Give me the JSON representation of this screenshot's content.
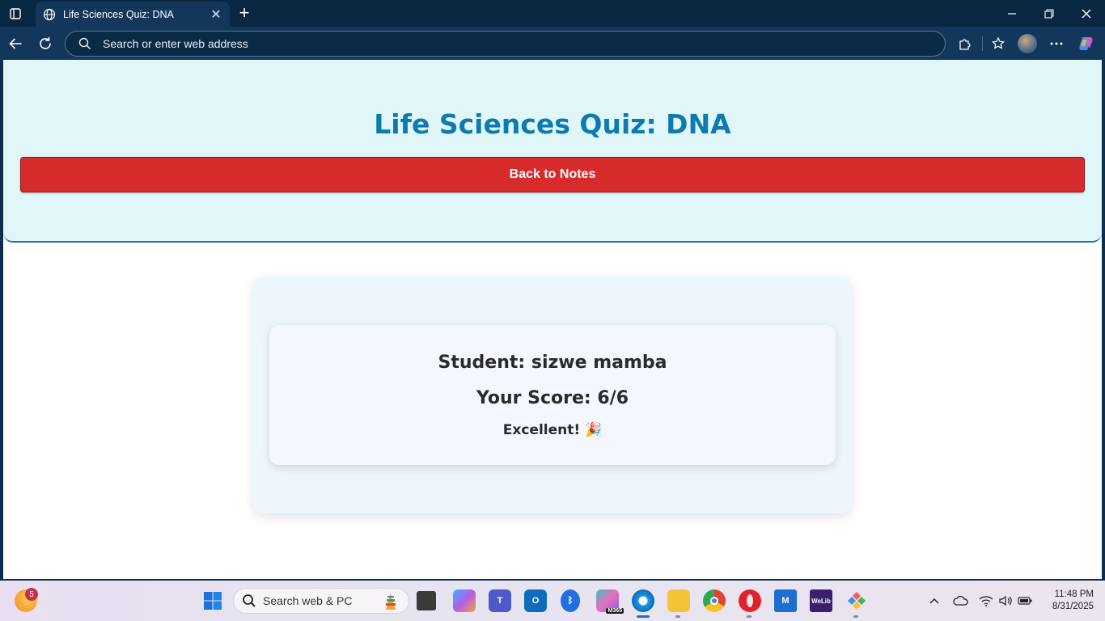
{
  "browser": {
    "tab_title": "Life Sciences Quiz: DNA",
    "address_placeholder": "Search or enter web address"
  },
  "page": {
    "title": "Life Sciences Quiz: DNA",
    "back_button": "Back to Notes",
    "result": {
      "student": "Student: sizwe mamba",
      "score": "Your Score: 6/6",
      "feedback": "Excellent! 🎉"
    }
  },
  "taskbar": {
    "search_placeholder": "Search web & PC",
    "weather_badge": "5",
    "m365_label": "M365",
    "welib_label": "WeLib",
    "time": "11:48 PM",
    "date": "8/31/2025"
  },
  "colors": {
    "header_bg": "#e0f6f8",
    "title": "#0b7bb0",
    "back_button": "#d62a2b",
    "card_bg": "#eef6fd"
  }
}
